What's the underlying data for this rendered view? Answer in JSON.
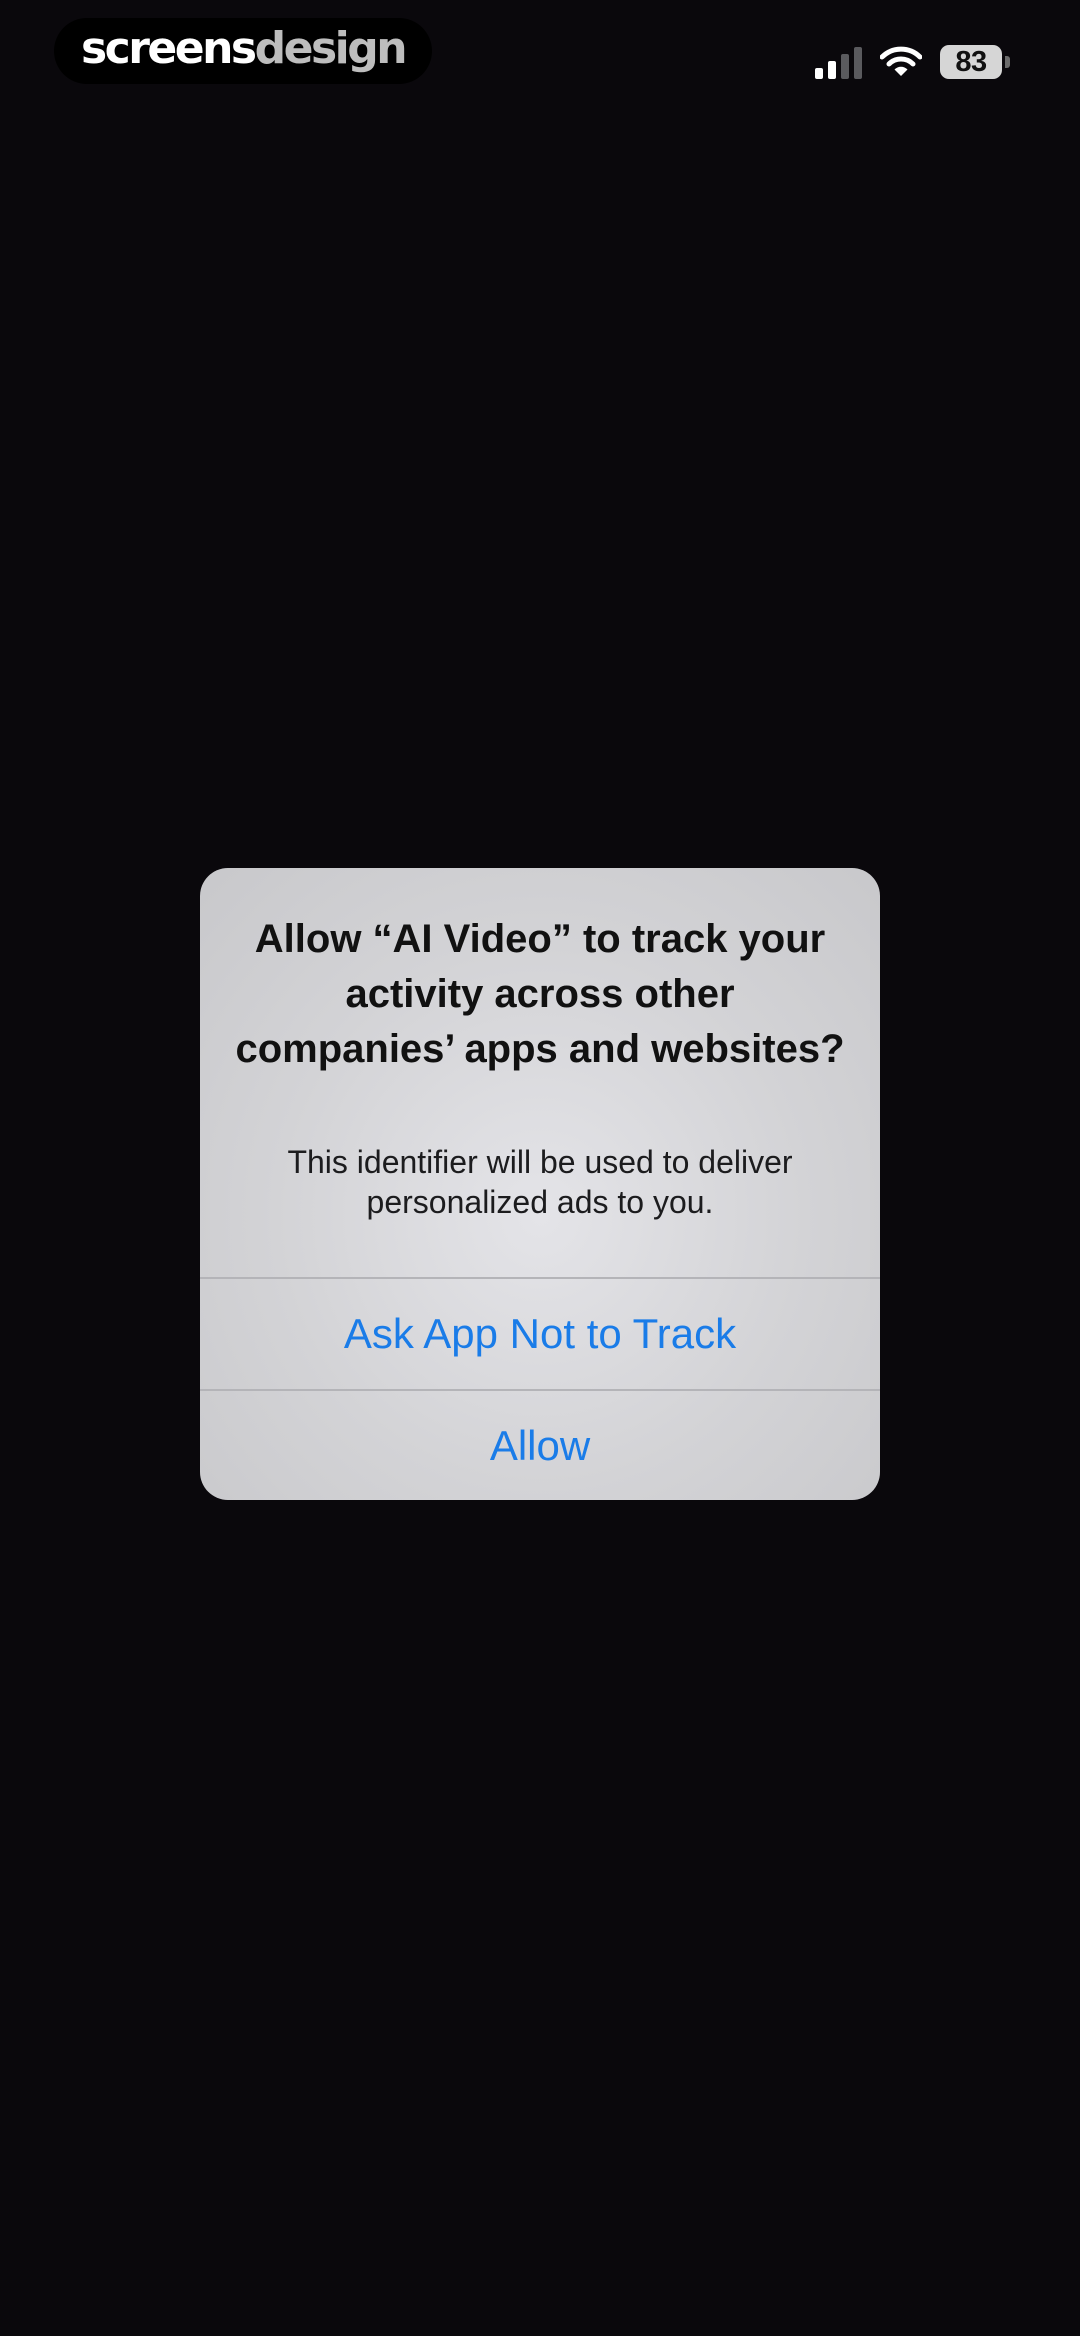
{
  "watermark": {
    "part1": "screens",
    "part2": "design"
  },
  "status_bar": {
    "signal_icon": "cellular-signal-icon",
    "wifi_icon": "wifi-icon",
    "battery_level": "83"
  },
  "alert": {
    "title": "Allow “AI Video” to track your activity across other companies’ apps and websites?",
    "message": "This identifier will be used to deliver personalized ads to you.",
    "buttons": {
      "ask_not_to_track": "Ask App Not to Track",
      "allow": "Allow"
    }
  },
  "colors": {
    "background": "#0a080c",
    "alert_background": "#d3d3d6",
    "button_text": "#1a7ce8"
  }
}
